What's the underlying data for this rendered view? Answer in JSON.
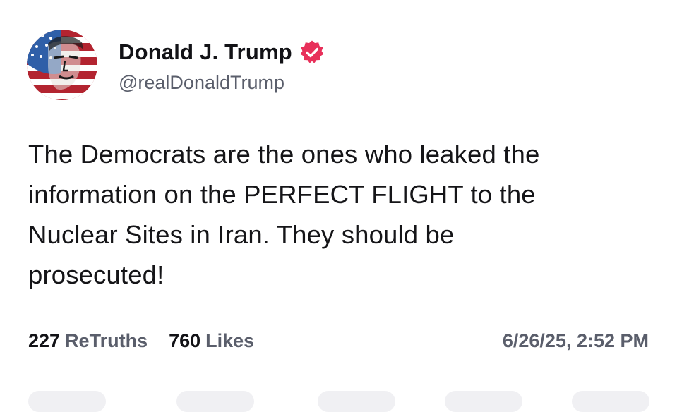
{
  "author": {
    "display_name": "Donald J. Trump",
    "handle": "@realDonaldTrump",
    "avatar_icon": "flag-portrait-avatar",
    "verified_icon": "verified-badge-icon",
    "verified_color": "#e8305a"
  },
  "post": {
    "text": "The Democrats are the ones who leaked the\ninformation on the PERFECT FLIGHT to the\nNuclear Sites in Iran. They should be\nprosecuted!"
  },
  "stats": {
    "retruths_count": "227",
    "retruths_label": "ReTruths",
    "likes_count": "760",
    "likes_label": "Likes"
  },
  "timestamp": "6/26/25, 2:52 PM",
  "colors": {
    "text_primary": "#121216",
    "text_secondary": "#5a5e6b",
    "background": "#ffffff"
  }
}
